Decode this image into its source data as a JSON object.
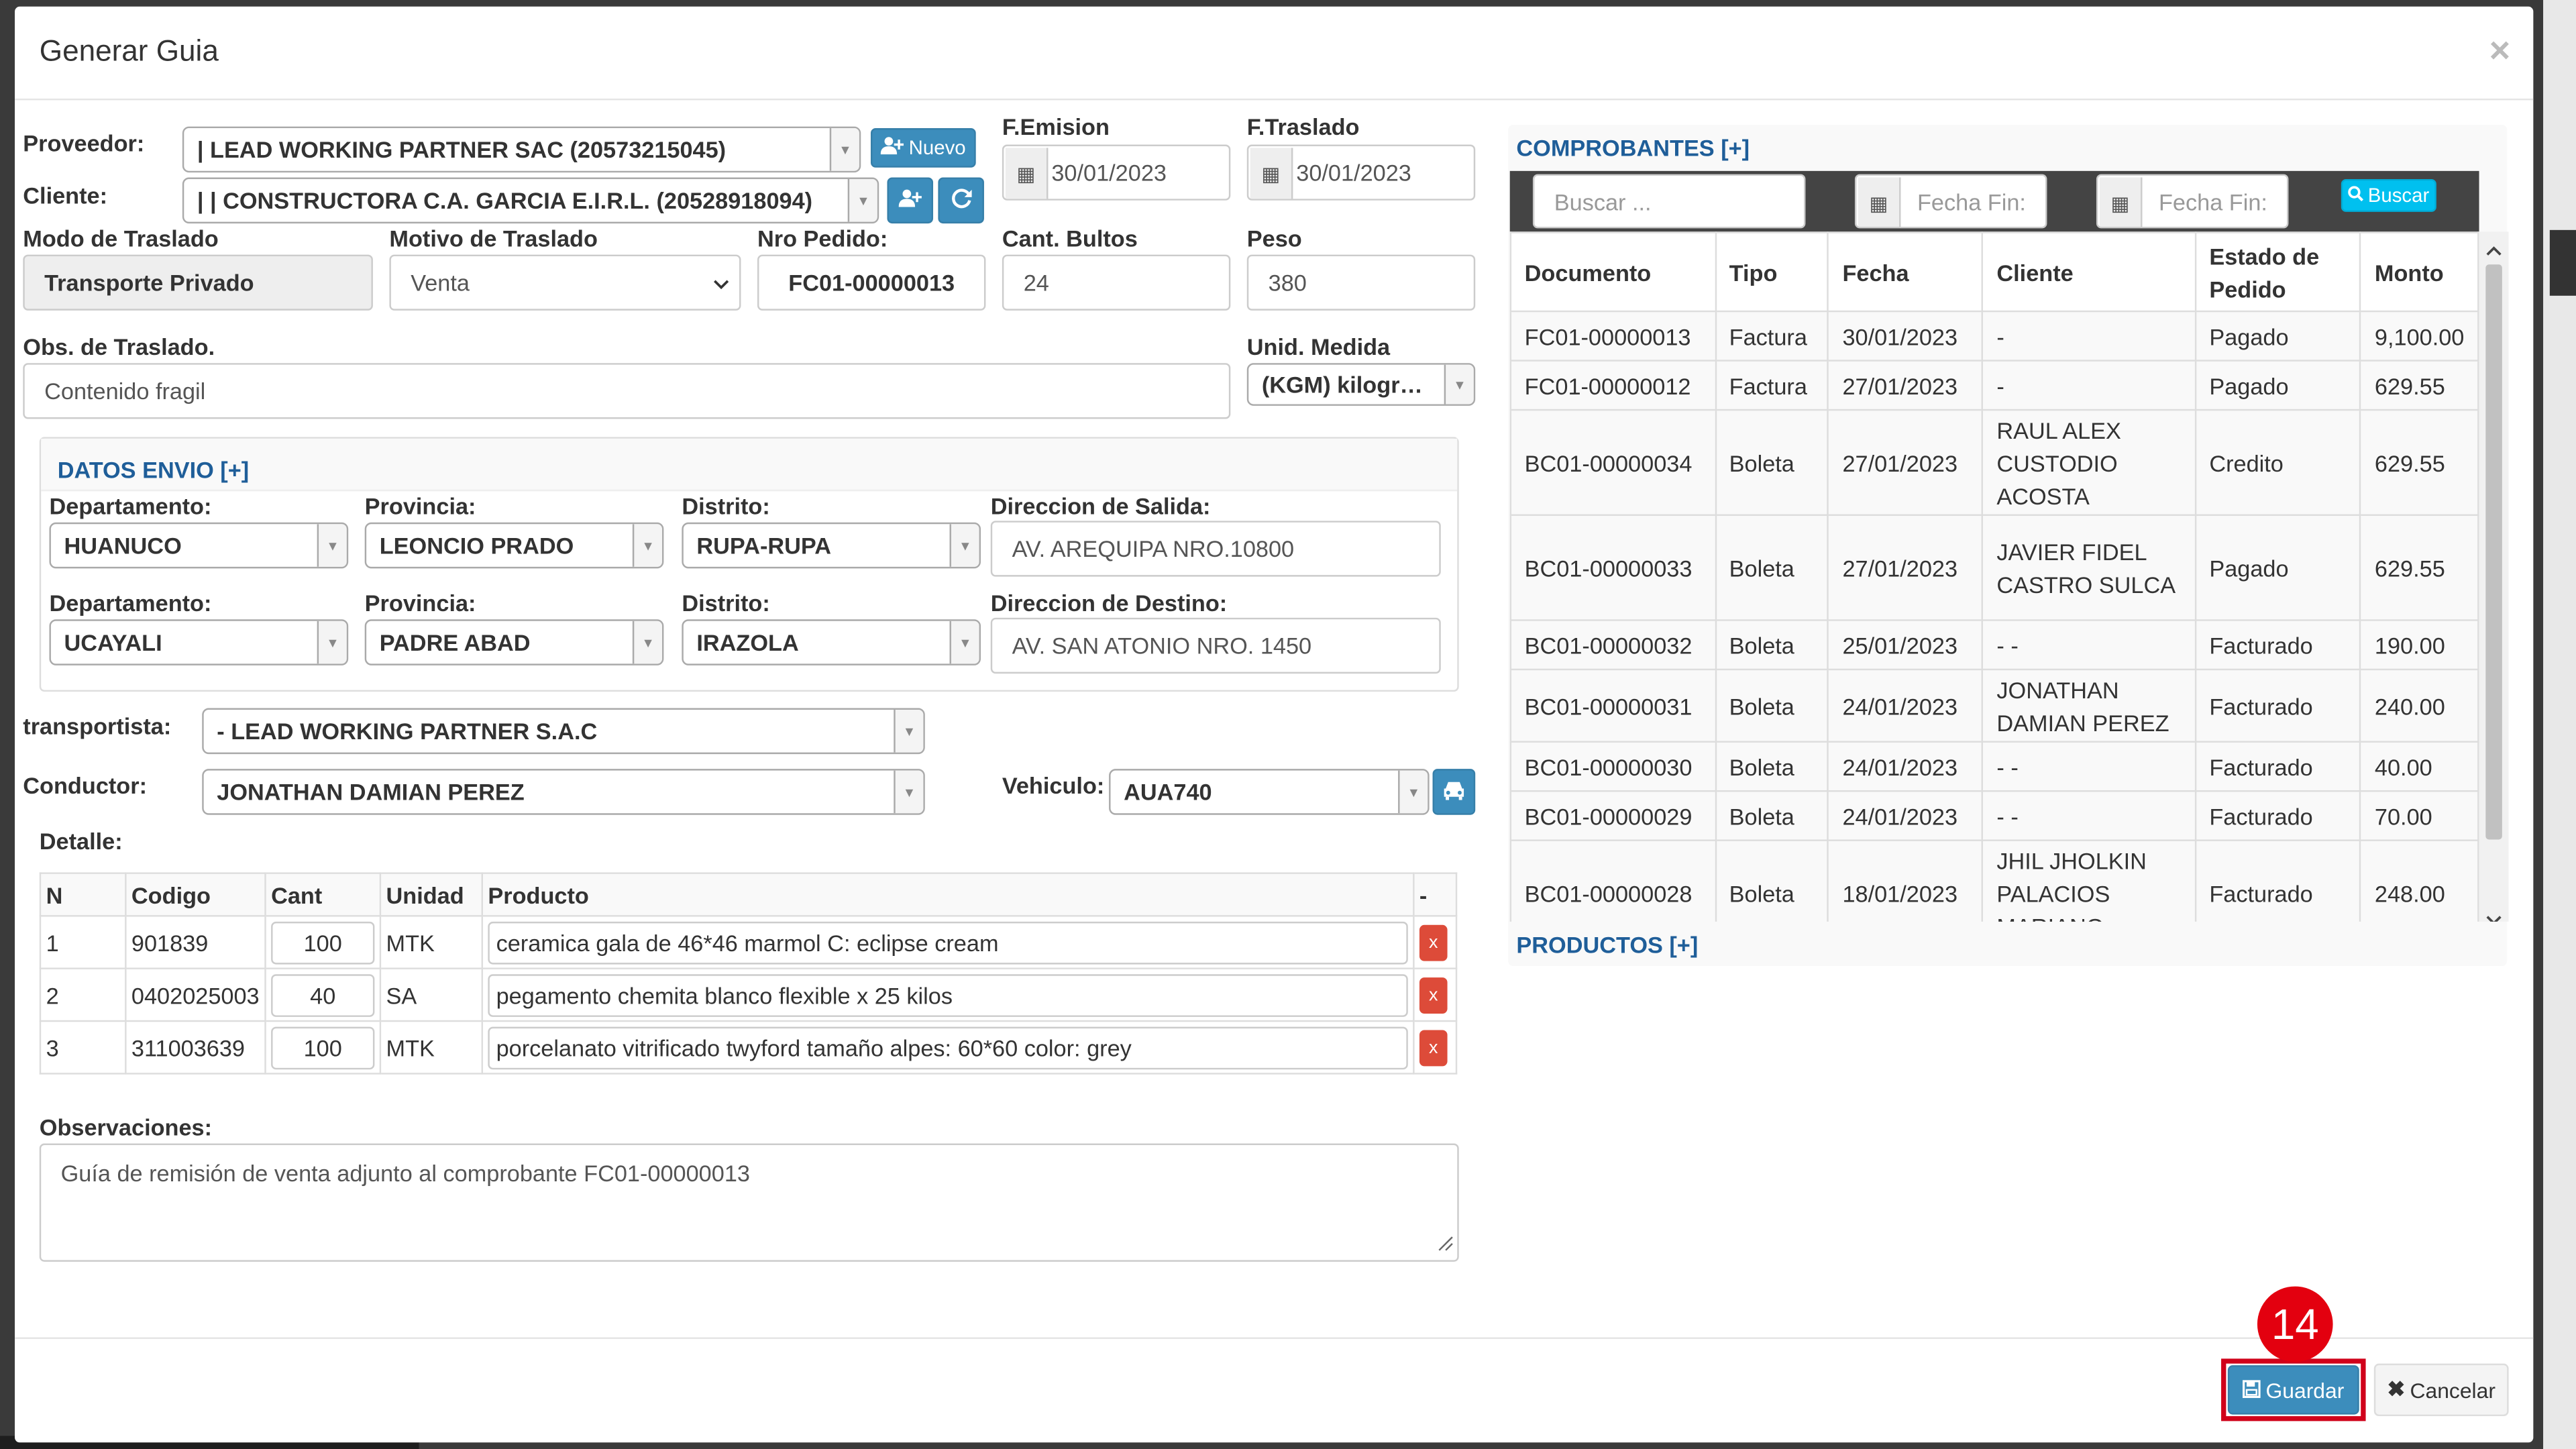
{
  "modal": {
    "title": "Generar Guia",
    "close": "×"
  },
  "form": {
    "proveedor": {
      "label": "Proveedor:",
      "value": "| LEAD WORKING PARTNER SAC (20573215045)",
      "nuevo_label": "Nuevo"
    },
    "cliente": {
      "label": "Cliente:",
      "value": "| | CONSTRUCTORA C.A. GARCIA E.I.R.L. (20528918094)"
    },
    "f_emision": {
      "label": "F.Emision",
      "value": "30/01/2023"
    },
    "f_traslado": {
      "label": "F.Traslado",
      "value": "30/01/2023"
    },
    "modo_traslado": {
      "label": "Modo de Traslado",
      "value": "Transporte Privado"
    },
    "motivo_traslado": {
      "label": "Motivo de Traslado",
      "value": "Venta"
    },
    "nro_pedido": {
      "label": "Nro Pedido:",
      "value": "FC01-00000013"
    },
    "cant_bultos": {
      "label": "Cant. Bultos",
      "value": "24"
    },
    "peso": {
      "label": "Peso",
      "value": "380"
    },
    "obs_traslado": {
      "label": "Obs. de Traslado.",
      "value": "Contenido fragil"
    },
    "unid_medida": {
      "label": "Unid. Medida",
      "value": "(KGM) kilogr…"
    }
  },
  "envio": {
    "title": "DATOS ENVIO [+]",
    "origen": {
      "dep_label": "Departamento:",
      "dep": "HUANUCO",
      "prov_label": "Provincia:",
      "prov": "LEONCIO PRADO",
      "dist_label": "Distrito:",
      "dist": "RUPA-RUPA",
      "dir_label": "Direccion de Salida:",
      "dir": "AV. AREQUIPA NRO.10800"
    },
    "destino": {
      "dep_label": "Departamento:",
      "dep": "UCAYALI",
      "prov_label": "Provincia:",
      "prov": "PADRE ABAD",
      "dist_label": "Distrito:",
      "dist": "IRAZOLA",
      "dir_label": "Direccion de Destino:",
      "dir": "AV. SAN ATONIO NRO. 1450"
    }
  },
  "transporte": {
    "transportista_label": "transportista:",
    "transportista": "- LEAD WORKING PARTNER S.A.C",
    "conductor_label": "Conductor:",
    "conductor": "JONATHAN DAMIAN PEREZ",
    "vehiculo_label": "Vehiculo:",
    "vehiculo": "AUA740"
  },
  "detalle": {
    "title": "Detalle:",
    "headers": [
      "N",
      "Codigo",
      "Cant",
      "Unidad",
      "Producto",
      "-"
    ],
    "rows": [
      {
        "n": "1",
        "codigo": "901839",
        "cant": "100",
        "unidad": "MTK",
        "producto": "ceramica gala de 46*46 marmol C: eclipse cream",
        "x": "x"
      },
      {
        "n": "2",
        "codigo": "0402025003",
        "cant": "40",
        "unidad": "SA",
        "producto": "pegamento chemita blanco flexible x 25 kilos",
        "x": "x"
      },
      {
        "n": "3",
        "codigo": "311003639",
        "cant": "100",
        "unidad": "MTK",
        "producto": "porcelanato vitrificado twyford tamaño alpes: 60*60 color: grey",
        "x": "x"
      }
    ]
  },
  "observaciones": {
    "label": "Observaciones:",
    "value": "Guía de remisión de venta adjunto al comprobante FC01-00000013"
  },
  "comprobantes": {
    "title": "COMPROBANTES [+]",
    "search_placeholder": "Buscar ...",
    "fecha1_placeholder": "Fecha Fin:",
    "fecha2_placeholder": "Fecha Fin:",
    "buscar_label": "Buscar",
    "headers": [
      "Documento",
      "Tipo",
      "Fecha",
      "Cliente",
      "Estado de Pedido",
      "Monto"
    ],
    "rows": [
      {
        "documento": "FC01-00000013",
        "tipo": "Factura",
        "fecha": "30/01/2023",
        "cliente": "-",
        "estado": "Pagado",
        "monto": "9,100.00"
      },
      {
        "documento": "FC01-00000012",
        "tipo": "Factura",
        "fecha": "27/01/2023",
        "cliente": "-",
        "estado": "Pagado",
        "monto": "629.55"
      },
      {
        "documento": "BC01-00000034",
        "tipo": "Boleta",
        "fecha": "27/01/2023",
        "cliente": "RAUL ALEX CUSTODIO ACOSTA",
        "estado": "Credito",
        "monto": "629.55"
      },
      {
        "documento": "BC01-00000033",
        "tipo": "Boleta",
        "fecha": "27/01/2023",
        "cliente": "JAVIER FIDEL CASTRO SULCA",
        "estado": "Pagado",
        "monto": "629.55"
      },
      {
        "documento": "BC01-00000032",
        "tipo": "Boleta",
        "fecha": "25/01/2023",
        "cliente": "- -",
        "estado": "Facturado",
        "monto": "190.00"
      },
      {
        "documento": "BC01-00000031",
        "tipo": "Boleta",
        "fecha": "24/01/2023",
        "cliente": "JONATHAN DAMIAN PEREZ",
        "estado": "Facturado",
        "monto": "240.00"
      },
      {
        "documento": "BC01-00000030",
        "tipo": "Boleta",
        "fecha": "24/01/2023",
        "cliente": "- -",
        "estado": "Facturado",
        "monto": "40.00"
      },
      {
        "documento": "BC01-00000029",
        "tipo": "Boleta",
        "fecha": "24/01/2023",
        "cliente": "- -",
        "estado": "Facturado",
        "monto": "70.00"
      },
      {
        "documento": "BC01-00000028",
        "tipo": "Boleta",
        "fecha": "18/01/2023",
        "cliente": "JHIL JHOLKIN PALACIOS MARIANO",
        "estado": "Facturado",
        "monto": "248.00"
      }
    ]
  },
  "productos": {
    "title": "PRODUCTOS [+]"
  },
  "footer": {
    "guardar_label": "Guardar",
    "cancelar_label": "Cancelar",
    "step_badge": "14"
  },
  "colors": {
    "primary": "#3c8dbc",
    "danger": "#dd4b39",
    "section_title": "#1f5e99",
    "highlight": "#d0021b"
  }
}
